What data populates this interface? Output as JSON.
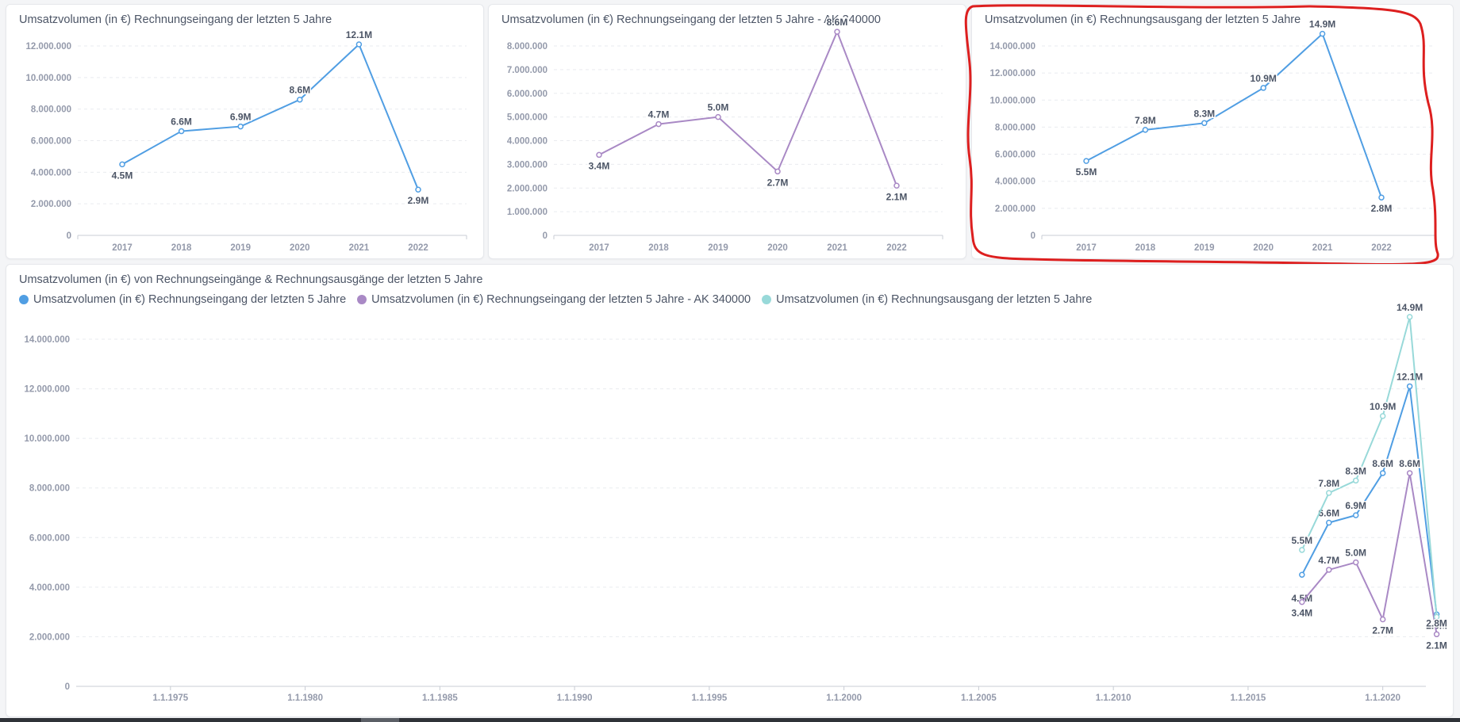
{
  "colors": {
    "blue": "#509ee3",
    "purple": "#a989c5",
    "teal": "#98d9d9",
    "axis": "#949aab",
    "text": "#4c5566",
    "label": "#4c5566",
    "highlight": "#dd1f1f"
  },
  "cards": [
    {
      "title": "Umsatzvolumen (in €) Rechnungseingang der letzten 5 Jahre"
    },
    {
      "title": "Umsatzvolumen (in €) Rechnungseingang der letzten 5 Jahre - AK 340000"
    },
    {
      "title": "Umsatzvolumen (in €) Rechnungsausgang der letzten 5 Jahre"
    },
    {
      "title": "Umsatzvolumen (in €) von Rechnungseingänge & Rechnungsausgänge der letzten 5 Jahre"
    }
  ],
  "chart_data": [
    {
      "type": "line",
      "title": "Umsatzvolumen (in €) Rechnungseingang der letzten 5 Jahre",
      "categories": [
        "2017",
        "2018",
        "2019",
        "2020",
        "2021",
        "2022"
      ],
      "values": [
        4500000,
        6600000,
        6900000,
        8600000,
        12100000,
        2900000
      ],
      "value_labels": [
        "4.5M",
        "6.6M",
        "6.9M",
        "8.6M",
        "12.1M",
        "2.9M"
      ],
      "y_ticks": [
        "0",
        "2.000.000",
        "4.000.000",
        "6.000.000",
        "8.000.000",
        "10.000.000",
        "12.000.000"
      ],
      "ylim": [
        0,
        12000000
      ],
      "color": "#509ee3",
      "grid": true
    },
    {
      "type": "line",
      "title": "Umsatzvolumen (in €) Rechnungseingang der letzten 5 Jahre - AK 340000",
      "categories": [
        "2017",
        "2018",
        "2019",
        "2020",
        "2021",
        "2022"
      ],
      "values": [
        3400000,
        4700000,
        5000000,
        2700000,
        8600000,
        2100000
      ],
      "value_labels": [
        "3.4M",
        "4.7M",
        "5.0M",
        "2.7M",
        "8.6M",
        "2.1M"
      ],
      "y_ticks": [
        "0",
        "1.000.000",
        "2.000.000",
        "3.000.000",
        "4.000.000",
        "5.000.000",
        "6.000.000",
        "7.000.000",
        "8.000.000"
      ],
      "ylim": [
        0,
        8000000
      ],
      "color": "#a989c5",
      "grid": true
    },
    {
      "type": "line",
      "title": "Umsatzvolumen (in €) Rechnungsausgang der letzten 5 Jahre",
      "categories": [
        "2017",
        "2018",
        "2019",
        "2020",
        "2021",
        "2022"
      ],
      "values": [
        5500000,
        7800000,
        8300000,
        10900000,
        14900000,
        2800000
      ],
      "value_labels": [
        "5.5M",
        "7.8M",
        "8.3M",
        "10.9M",
        "14.9M",
        "2.8M"
      ],
      "y_ticks": [
        "0",
        "2.000.000",
        "4.000.000",
        "6.000.000",
        "8.000.000",
        "10.000.000",
        "12.000.000",
        "14.000.000"
      ],
      "ylim": [
        0,
        14000000
      ],
      "color": "#509ee3",
      "grid": true,
      "highlighted": true
    },
    {
      "type": "line",
      "title": "Umsatzvolumen (in €) von Rechnungseingänge & Rechnungsausgänge der letzten 5 Jahre",
      "x_ticks": [
        "1.1.1975",
        "1.1.1980",
        "1.1.1985",
        "1.1.1990",
        "1.1.1995",
        "1.1.2000",
        "1.1.2005",
        "1.1.2010",
        "1.1.2015",
        "1.1.2020"
      ],
      "x_tick_years": [
        1975,
        1980,
        1985,
        1990,
        1995,
        2000,
        2005,
        2010,
        2015,
        2020
      ],
      "xlim": [
        1971.5,
        2021.6
      ],
      "y_ticks": [
        "0",
        "2.000.000",
        "4.000.000",
        "6.000.000",
        "8.000.000",
        "10.000.000",
        "12.000.000",
        "14.000.000"
      ],
      "ylim": [
        0,
        14000000
      ],
      "legend_position": "top-left",
      "grid": true,
      "series": [
        {
          "name": "Umsatzvolumen (in €) Rechnungseingang der letzten 5 Jahre",
          "color": "#509ee3",
          "x": [
            2017,
            2018,
            2019,
            2020,
            2021,
            2022
          ],
          "values": [
            4500000,
            6600000,
            6900000,
            8600000,
            12100000,
            2900000
          ],
          "value_labels": [
            "4.5M",
            "6.6M",
            "6.9M",
            "8.6M",
            "12.1M",
            "2.9M"
          ]
        },
        {
          "name": "Umsatzvolumen (in €) Rechnungseingang der letzten 5 Jahre - AK 340000",
          "color": "#a989c5",
          "x": [
            2017,
            2018,
            2019,
            2020,
            2021,
            2022
          ],
          "values": [
            3400000,
            4700000,
            5000000,
            2700000,
            8600000,
            2100000
          ],
          "value_labels": [
            "3.4M",
            "4.7M",
            "5.0M",
            "2.7M",
            "8.6M",
            "2.1M"
          ]
        },
        {
          "name": "Umsatzvolumen (in €) Rechnungsausgang der letzten 5 Jahre",
          "color": "#98d9d9",
          "x": [
            2017,
            2018,
            2019,
            2020,
            2021,
            2022
          ],
          "values": [
            5500000,
            7800000,
            8300000,
            10900000,
            14900000,
            2800000
          ],
          "value_labels": [
            "5.5M",
            "7.8M",
            "8.3M",
            "10.9M",
            "14.9M",
            "2.8M"
          ]
        }
      ]
    }
  ]
}
